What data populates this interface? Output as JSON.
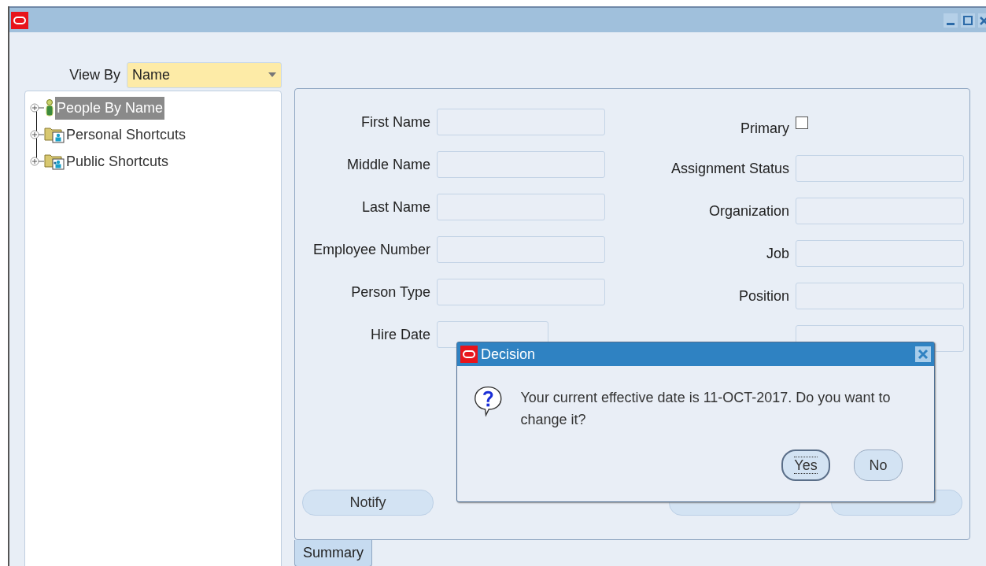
{
  "view_by": {
    "label": "View By",
    "value": "Name"
  },
  "tree": [
    {
      "label": "People By Name",
      "kind": "person",
      "selected": true,
      "expanded": false
    },
    {
      "label": "Personal Shortcuts",
      "kind": "personal-folder",
      "selected": false,
      "expanded": false
    },
    {
      "label": "Public Shortcuts",
      "kind": "public-folder",
      "selected": false,
      "expanded": false
    }
  ],
  "form": {
    "left_fields": [
      {
        "label": "First Name",
        "kind": "text"
      },
      {
        "label": "Middle Name",
        "kind": "text"
      },
      {
        "label": "Last Name",
        "kind": "text"
      },
      {
        "label": "Employee Number",
        "kind": "text"
      },
      {
        "label": "Person Type",
        "kind": "text"
      },
      {
        "label": "Hire Date",
        "kind": "date"
      }
    ],
    "right_fields": [
      {
        "label": "Primary",
        "kind": "checkbox",
        "checked": false
      },
      {
        "label": "Assignment Status",
        "kind": "text"
      },
      {
        "label": "Organization",
        "kind": "text"
      },
      {
        "label": "Job",
        "kind": "text"
      },
      {
        "label": "Position",
        "kind": "text"
      },
      {
        "kind": "text"
      }
    ],
    "buttons": [
      {
        "label": "Notify"
      }
    ]
  },
  "tabs": [
    {
      "label": "Summary",
      "selected": true
    }
  ],
  "dialog": {
    "title": "Decision",
    "message": "Your current effective date is 11-OCT-2017. Do you want to change it?",
    "buttons": [
      {
        "label": "Yes",
        "focused": true
      },
      {
        "label": "No",
        "focused": false
      }
    ]
  }
}
